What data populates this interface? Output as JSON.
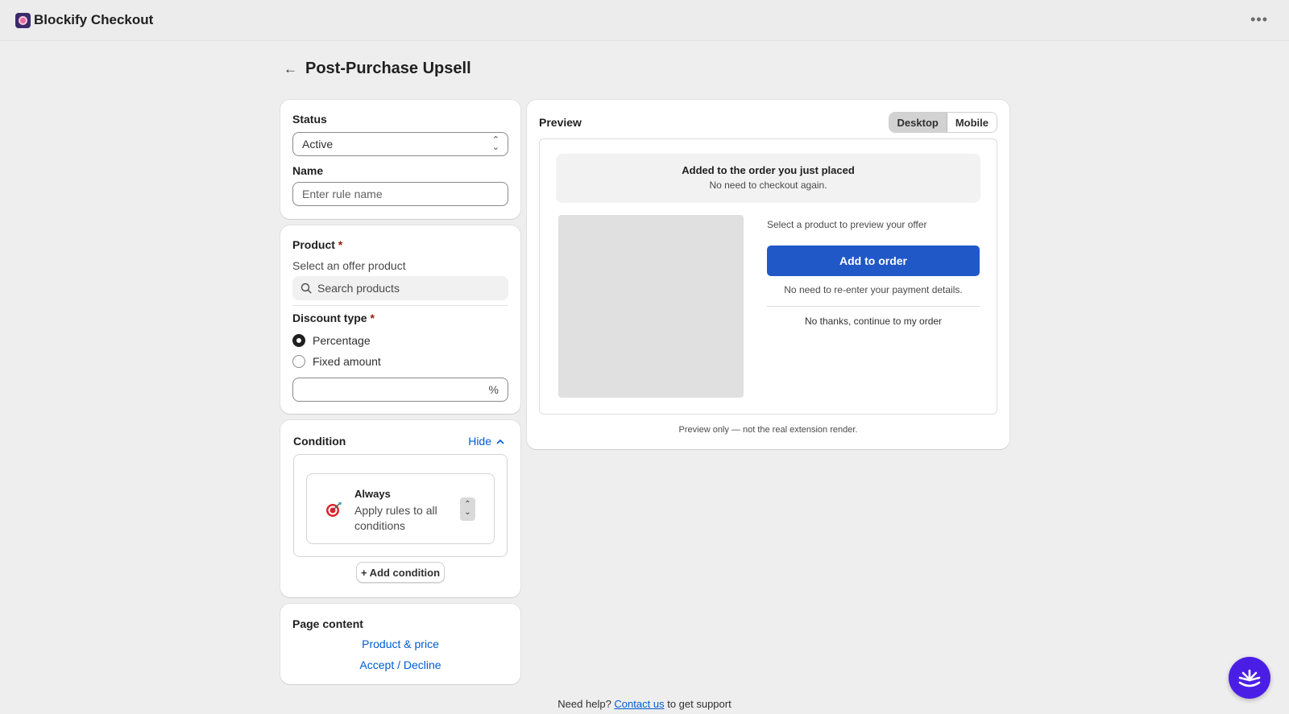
{
  "app": {
    "title": "Blockify Checkout"
  },
  "header": {
    "title": "Post-Purchase Upsell"
  },
  "status": {
    "label": "Status",
    "value": "Active"
  },
  "name": {
    "label": "Name",
    "placeholder": "Enter rule name"
  },
  "product": {
    "label": "Product",
    "required_mark": "*",
    "help": "Select an offer product",
    "search_placeholder": "Search products"
  },
  "discount": {
    "label": "Discount type",
    "required_mark": "*",
    "options": [
      {
        "label": "Percentage",
        "selected": true
      },
      {
        "label": "Fixed amount",
        "selected": false
      }
    ],
    "suffix": "%"
  },
  "condition": {
    "label": "Condition",
    "toggle_label": "Hide",
    "item_title": "Always",
    "item_desc": "Apply rules to all conditions",
    "add_label": "+ Add condition"
  },
  "page_content": {
    "label": "Page content",
    "links": [
      "Product & price",
      "Accept / Decline"
    ]
  },
  "preview": {
    "label": "Preview",
    "tabs": [
      "Desktop",
      "Mobile"
    ],
    "active_tab": "Desktop",
    "banner_title": "Added to the order you just placed",
    "banner_sub": "No need to checkout again.",
    "offer_hint": "Select a product to preview your offer",
    "cta": "Add to order",
    "cta_note": "No need to re-enter your payment details.",
    "decline": "No thanks, continue to my order",
    "footnote": "Preview only — not the real extension render."
  },
  "footer": {
    "prefix": "Need help?",
    "link": "Contact us",
    "suffix": "to get support"
  },
  "colors": {
    "primary": "#2158c7",
    "link": "#005bd3",
    "required": "#8e1f0b",
    "chat": "#4b1ee6"
  }
}
